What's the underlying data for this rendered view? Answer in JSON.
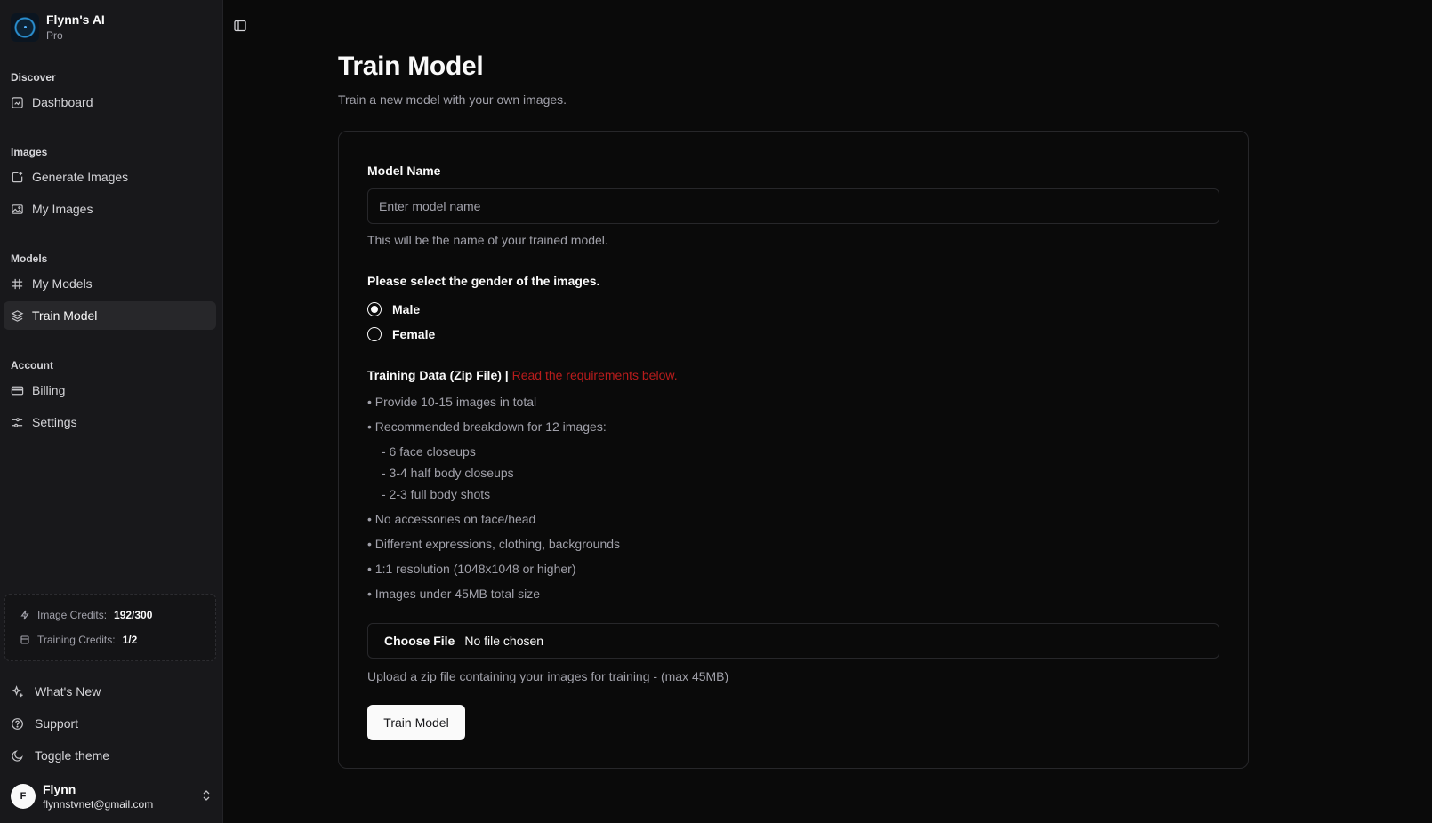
{
  "app": {
    "name": "Flynn's AI",
    "plan": "Pro"
  },
  "sidebar": {
    "sections": [
      {
        "label": "Discover",
        "items": [
          {
            "label": "Dashboard",
            "icon": "dashboard-icon"
          }
        ]
      },
      {
        "label": "Images",
        "items": [
          {
            "label": "Generate Images",
            "icon": "image-plus-icon"
          },
          {
            "label": "My Images",
            "icon": "images-icon"
          }
        ]
      },
      {
        "label": "Models",
        "items": [
          {
            "label": "My Models",
            "icon": "hash-icon"
          },
          {
            "label": "Train Model",
            "icon": "layers-icon",
            "active": true
          }
        ]
      },
      {
        "label": "Account",
        "items": [
          {
            "label": "Billing",
            "icon": "credit-card-icon"
          },
          {
            "label": "Settings",
            "icon": "sliders-icon"
          }
        ]
      }
    ],
    "credits": {
      "image_label": "Image Credits:",
      "image_value": "192/300",
      "training_label": "Training Credits:",
      "training_value": "1/2"
    },
    "footer": {
      "whats_new": "What's New",
      "support": "Support",
      "toggle_theme": "Toggle theme"
    },
    "user": {
      "initial": "F",
      "name": "Flynn",
      "email": "flynnstvnet@gmail.com"
    }
  },
  "main": {
    "title": "Train Model",
    "subtitle": "Train a new model with your own images.",
    "form": {
      "model_name_label": "Model Name",
      "model_name_placeholder": "Enter model name",
      "model_name_value": "",
      "model_name_help": "This will be the name of your trained model.",
      "gender_label": "Please select the gender of the images.",
      "gender_options": [
        "Male",
        "Female"
      ],
      "gender_selected": "Male",
      "training_label": "Training Data (Zip File) |",
      "training_link": "Read the requirements below.",
      "requirements": [
        "• Provide 10-15 images in total",
        "• Recommended breakdown for 12 images:",
        "- 6 face closeups",
        "- 3-4 half body closeups",
        "- 2-3 full body shots",
        "• No accessories on face/head",
        "• Different expressions, clothing, backgrounds",
        "• 1:1 resolution (1048x1048 or higher)",
        "• Images under 45MB total size"
      ],
      "file_button": "Choose File",
      "file_status": "No file chosen",
      "file_help": "Upload a zip file containing your images for training - (max 45MB)",
      "submit_label": "Train Model"
    }
  },
  "colors": {
    "background": "#0a0a0a",
    "sidebar": "#18181b",
    "accent_link": "#b91c1c",
    "button": "#fafafa"
  }
}
